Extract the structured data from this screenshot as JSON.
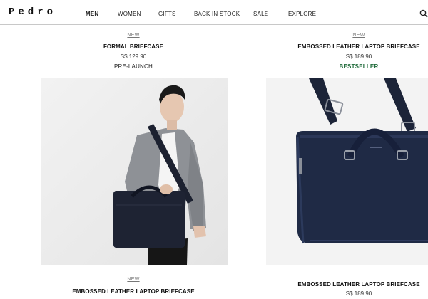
{
  "brand": {
    "logo": "Pedro"
  },
  "nav": {
    "items": [
      {
        "label": "MEN",
        "active": true
      },
      {
        "label": "WOMEN",
        "active": false
      },
      {
        "label": "GIFTS",
        "active": false
      },
      {
        "label": "BACK IN STOCK",
        "active": false
      },
      {
        "label": "SALE",
        "active": false
      },
      {
        "label": "EXPLORE",
        "active": false
      }
    ],
    "search_icon": "search-icon"
  },
  "products": [
    {
      "badge": "NEW",
      "name": "FORMAL BRIEFCASE",
      "price": "S$ 129.90",
      "tag": "PRE-LAUNCH"
    },
    {
      "badge": "NEW",
      "name": "EMBOSSED LEATHER LAPTOP BRIEFCASE",
      "price": "S$ 189.90",
      "tag": "BESTSELLER"
    },
    {
      "badge": "NEW",
      "name": "EMBOSSED LEATHER LAPTOP BRIEFCASE",
      "price": "",
      "tag": ""
    },
    {
      "badge": "",
      "name": "EMBOSSED LEATHER LAPTOP BRIEFCASE",
      "price": "S$ 189.90",
      "tag": ""
    }
  ],
  "colors": {
    "accent_green": "#1f6b3a",
    "bag_navy": "#1f2a45",
    "text": "#222222"
  }
}
